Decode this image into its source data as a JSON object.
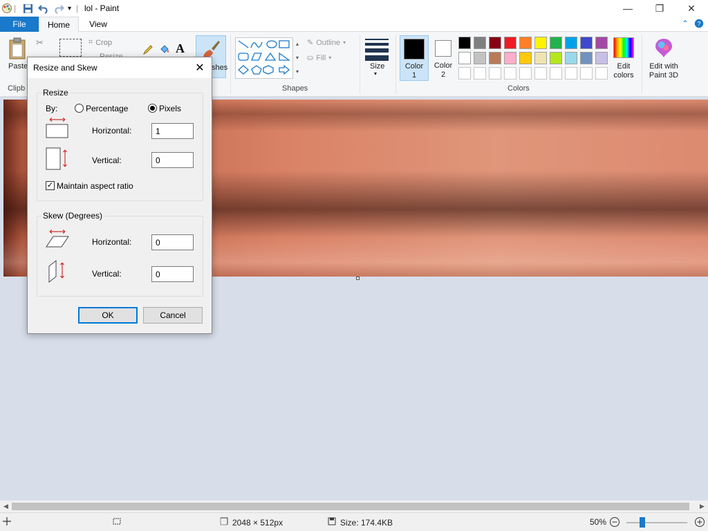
{
  "window": {
    "title": "lol - Paint",
    "minimize_glyph": "—",
    "maximize_glyph": "❐",
    "close_glyph": "✕"
  },
  "ribbon": {
    "tabs": [
      {
        "label": "File"
      },
      {
        "label": "Home"
      },
      {
        "label": "View"
      }
    ],
    "clipboard": {
      "paste_label": "Paste",
      "group_label": "Clipb"
    },
    "image": {
      "crop_label": "Crop",
      "resize_label": "Resize"
    },
    "brushes_label": "shes",
    "shapes": {
      "outline_label": "Outline",
      "fill_label": "Fill",
      "group_label": "Shapes"
    },
    "size_label": "Size",
    "color1_label": "Color 1",
    "color1_line1": "Color",
    "color1_line2": "1",
    "color2_line1": "Color",
    "color2_line2": "2",
    "colors_group_label": "Colors",
    "edit_colors_line1": "Edit",
    "edit_colors_line2": "colors",
    "paint3d_line1": "Edit with",
    "paint3d_line2": "Paint 3D",
    "palette_row1": [
      "#000000",
      "#7f7f7f",
      "#880015",
      "#ed1c24",
      "#ff7f27",
      "#fff200",
      "#22b14c",
      "#00a2e8",
      "#3f48cc",
      "#a349a4"
    ],
    "palette_row2": [
      "#ffffff",
      "#c3c3c3",
      "#b97a57",
      "#ffaec9",
      "#ffc90e",
      "#efe4b0",
      "#b5e61d",
      "#99d9ea",
      "#7092be",
      "#c8bfe7"
    ],
    "color1_value": "#000000",
    "color2_value": "#ffffff"
  },
  "dialog": {
    "title": "Resize and Skew",
    "resize_legend": "Resize",
    "by_label": "By:",
    "percentage_label": "Percentage",
    "pixels_label": "Pixels",
    "resize_mode": "Pixels",
    "horizontal_label": "Horizontal:",
    "vertical_label": "Vertical:",
    "resize_horizontal_value": "1",
    "resize_vertical_value": "0",
    "maintain_aspect_label": "Maintain aspect ratio",
    "maintain_aspect_checked": true,
    "skew_legend": "Skew (Degrees)",
    "skew_horizontal_value": "0",
    "skew_vertical_value": "0",
    "ok_label": "OK",
    "cancel_label": "Cancel"
  },
  "status": {
    "dimensions": "2048 × 512px",
    "size": "Size: 174.4KB",
    "zoom": "50%"
  }
}
